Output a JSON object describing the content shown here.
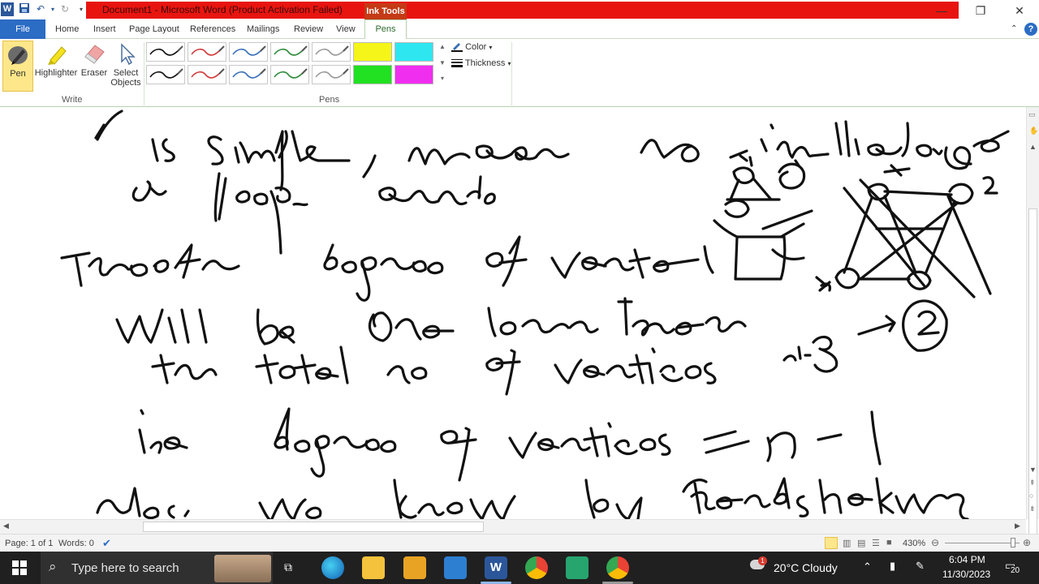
{
  "window": {
    "title": "Document1 - Microsoft Word (Product Activation Failed)",
    "contextual_tab": "Ink Tools",
    "minimize": "—",
    "restore": "❐",
    "close": "✕"
  },
  "tabs": {
    "file": "File",
    "items": [
      "Home",
      "Insert",
      "Page Layout",
      "References",
      "Mailings",
      "Review",
      "View"
    ],
    "active": "Pens"
  },
  "ribbon": {
    "write_group": {
      "label": "Write",
      "pen": "Pen",
      "highlighter": "Highlighter",
      "eraser": "Eraser",
      "select_objects_line1": "Select",
      "select_objects_line2": "Objects"
    },
    "pens_group": {
      "label": "Pens",
      "swatches": [
        {
          "color": "#111111",
          "type": "line"
        },
        {
          "color": "#d23a3a",
          "type": "line"
        },
        {
          "color": "#3a70b8",
          "type": "line"
        },
        {
          "color": "#2f8a3a",
          "type": "line"
        },
        {
          "color": "#9a9a9a",
          "type": "line"
        },
        {
          "color": "#f5f51a",
          "type": "highlighter"
        },
        {
          "color": "#2ee6f0",
          "type": "highlighter"
        },
        {
          "color": "#111111",
          "type": "line"
        },
        {
          "color": "#d23a3a",
          "type": "line"
        },
        {
          "color": "#3a70b8",
          "type": "line"
        },
        {
          "color": "#2f8a3a",
          "type": "line"
        },
        {
          "color": "#9a9a9a",
          "type": "line"
        },
        {
          "color": "#22e022",
          "type": "highlighter"
        },
        {
          "color": "#f02ef0",
          "type": "highlighter"
        }
      ]
    },
    "color_label": "Color",
    "thickness_label": "Thickness"
  },
  "status": {
    "page": "Page: 1 of 1",
    "words": "Words: 0",
    "zoom": "430%"
  },
  "taskbar": {
    "search_placeholder": "Type here to search",
    "weather": "20°C  Cloudy",
    "time": "6:04 PM",
    "date": "11/30/2023",
    "notification_count": "20",
    "weather_badge": "1"
  },
  "colors": {
    "title_red": "#e8140f",
    "file_blue": "#2b6cc4",
    "pens_green": "#2e6b2e",
    "taskbar_bg": "#202020"
  }
}
